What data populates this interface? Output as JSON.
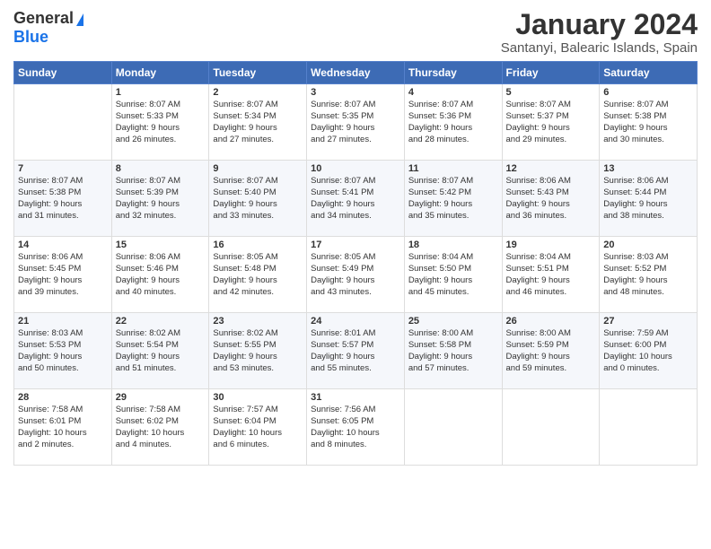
{
  "header": {
    "logo_general": "General",
    "logo_blue": "Blue",
    "month_title": "January 2024",
    "location": "Santanyi, Balearic Islands, Spain"
  },
  "days_of_week": [
    "Sunday",
    "Monday",
    "Tuesday",
    "Wednesday",
    "Thursday",
    "Friday",
    "Saturday"
  ],
  "weeks": [
    [
      {
        "day": "",
        "info": ""
      },
      {
        "day": "1",
        "info": "Sunrise: 8:07 AM\nSunset: 5:33 PM\nDaylight: 9 hours\nand 26 minutes."
      },
      {
        "day": "2",
        "info": "Sunrise: 8:07 AM\nSunset: 5:34 PM\nDaylight: 9 hours\nand 27 minutes."
      },
      {
        "day": "3",
        "info": "Sunrise: 8:07 AM\nSunset: 5:35 PM\nDaylight: 9 hours\nand 27 minutes."
      },
      {
        "day": "4",
        "info": "Sunrise: 8:07 AM\nSunset: 5:36 PM\nDaylight: 9 hours\nand 28 minutes."
      },
      {
        "day": "5",
        "info": "Sunrise: 8:07 AM\nSunset: 5:37 PM\nDaylight: 9 hours\nand 29 minutes."
      },
      {
        "day": "6",
        "info": "Sunrise: 8:07 AM\nSunset: 5:38 PM\nDaylight: 9 hours\nand 30 minutes."
      }
    ],
    [
      {
        "day": "7",
        "info": "Sunrise: 8:07 AM\nSunset: 5:38 PM\nDaylight: 9 hours\nand 31 minutes."
      },
      {
        "day": "8",
        "info": "Sunrise: 8:07 AM\nSunset: 5:39 PM\nDaylight: 9 hours\nand 32 minutes."
      },
      {
        "day": "9",
        "info": "Sunrise: 8:07 AM\nSunset: 5:40 PM\nDaylight: 9 hours\nand 33 minutes."
      },
      {
        "day": "10",
        "info": "Sunrise: 8:07 AM\nSunset: 5:41 PM\nDaylight: 9 hours\nand 34 minutes."
      },
      {
        "day": "11",
        "info": "Sunrise: 8:07 AM\nSunset: 5:42 PM\nDaylight: 9 hours\nand 35 minutes."
      },
      {
        "day": "12",
        "info": "Sunrise: 8:06 AM\nSunset: 5:43 PM\nDaylight: 9 hours\nand 36 minutes."
      },
      {
        "day": "13",
        "info": "Sunrise: 8:06 AM\nSunset: 5:44 PM\nDaylight: 9 hours\nand 38 minutes."
      }
    ],
    [
      {
        "day": "14",
        "info": "Sunrise: 8:06 AM\nSunset: 5:45 PM\nDaylight: 9 hours\nand 39 minutes."
      },
      {
        "day": "15",
        "info": "Sunrise: 8:06 AM\nSunset: 5:46 PM\nDaylight: 9 hours\nand 40 minutes."
      },
      {
        "day": "16",
        "info": "Sunrise: 8:05 AM\nSunset: 5:48 PM\nDaylight: 9 hours\nand 42 minutes."
      },
      {
        "day": "17",
        "info": "Sunrise: 8:05 AM\nSunset: 5:49 PM\nDaylight: 9 hours\nand 43 minutes."
      },
      {
        "day": "18",
        "info": "Sunrise: 8:04 AM\nSunset: 5:50 PM\nDaylight: 9 hours\nand 45 minutes."
      },
      {
        "day": "19",
        "info": "Sunrise: 8:04 AM\nSunset: 5:51 PM\nDaylight: 9 hours\nand 46 minutes."
      },
      {
        "day": "20",
        "info": "Sunrise: 8:03 AM\nSunset: 5:52 PM\nDaylight: 9 hours\nand 48 minutes."
      }
    ],
    [
      {
        "day": "21",
        "info": "Sunrise: 8:03 AM\nSunset: 5:53 PM\nDaylight: 9 hours\nand 50 minutes."
      },
      {
        "day": "22",
        "info": "Sunrise: 8:02 AM\nSunset: 5:54 PM\nDaylight: 9 hours\nand 51 minutes."
      },
      {
        "day": "23",
        "info": "Sunrise: 8:02 AM\nSunset: 5:55 PM\nDaylight: 9 hours\nand 53 minutes."
      },
      {
        "day": "24",
        "info": "Sunrise: 8:01 AM\nSunset: 5:57 PM\nDaylight: 9 hours\nand 55 minutes."
      },
      {
        "day": "25",
        "info": "Sunrise: 8:00 AM\nSunset: 5:58 PM\nDaylight: 9 hours\nand 57 minutes."
      },
      {
        "day": "26",
        "info": "Sunrise: 8:00 AM\nSunset: 5:59 PM\nDaylight: 9 hours\nand 59 minutes."
      },
      {
        "day": "27",
        "info": "Sunrise: 7:59 AM\nSunset: 6:00 PM\nDaylight: 10 hours\nand 0 minutes."
      }
    ],
    [
      {
        "day": "28",
        "info": "Sunrise: 7:58 AM\nSunset: 6:01 PM\nDaylight: 10 hours\nand 2 minutes."
      },
      {
        "day": "29",
        "info": "Sunrise: 7:58 AM\nSunset: 6:02 PM\nDaylight: 10 hours\nand 4 minutes."
      },
      {
        "day": "30",
        "info": "Sunrise: 7:57 AM\nSunset: 6:04 PM\nDaylight: 10 hours\nand 6 minutes."
      },
      {
        "day": "31",
        "info": "Sunrise: 7:56 AM\nSunset: 6:05 PM\nDaylight: 10 hours\nand 8 minutes."
      },
      {
        "day": "",
        "info": ""
      },
      {
        "day": "",
        "info": ""
      },
      {
        "day": "",
        "info": ""
      }
    ]
  ]
}
